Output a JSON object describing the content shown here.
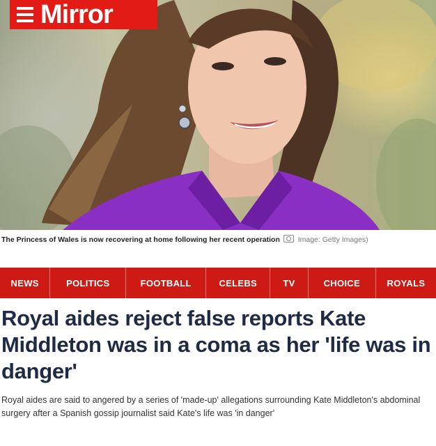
{
  "brand": {
    "name": "Mirror",
    "color": "#e21b16"
  },
  "hero": {
    "caption": "The Princess of Wales is now recovering at home following her recent operation",
    "credit": "Image: Getty Images)"
  },
  "nav": {
    "color": "#cd1a14",
    "items": [
      {
        "label": "NEWS"
      },
      {
        "label": "POLITICS"
      },
      {
        "label": "FOOTBALL"
      },
      {
        "label": "CELEBS"
      },
      {
        "label": "TV"
      },
      {
        "label": "CHOICE"
      },
      {
        "label": "ROYALS"
      }
    ]
  },
  "article": {
    "headline": "Royal aides reject false reports Kate Middleton was in a coma as her 'life was in danger'",
    "standfirst": "Royal aides are said to angered by a series of 'made-up' allegations surrounding Kate Middleton's abdominal surgery after a Spanish gossip journalist said Kate's life was 'in danger'"
  }
}
